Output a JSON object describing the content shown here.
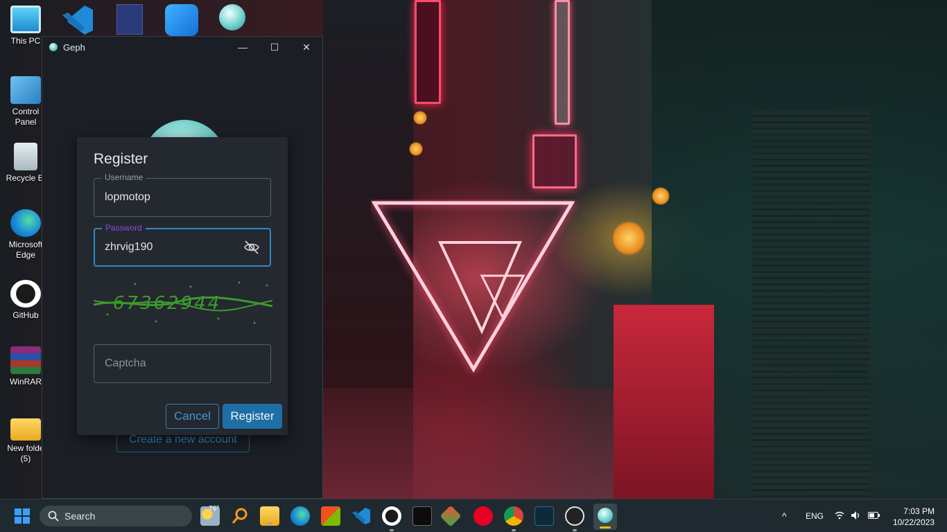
{
  "desktop": {
    "icons": [
      {
        "label": "This PC",
        "icon": "this-pc-icon"
      },
      {
        "label": "Control Panel",
        "icon": "control-panel-icon"
      },
      {
        "label": "Recycle Bi",
        "icon": "recycle-bin-icon"
      },
      {
        "label": "Microsoft Edge",
        "icon": "edge-icon"
      },
      {
        "label": "GitHub",
        "icon": "github-icon"
      },
      {
        "label": "WinRAR",
        "icon": "winrar-icon"
      },
      {
        "label": "New folde (5)",
        "icon": "folder-icon"
      }
    ],
    "top_row_icons": [
      "vscode-icon",
      "calculator-app-icon",
      "shareit-icon",
      "geph-icon"
    ]
  },
  "window": {
    "title": "Geph",
    "minimize_symbol": "—",
    "maximize_symbol": "☐",
    "close_symbol": "✕",
    "create_account_label": "Create a new account"
  },
  "register_dialog": {
    "title": "Register",
    "username": {
      "label": "Username",
      "value": "lopmotop"
    },
    "password": {
      "label": "Password",
      "value": "zhrvig190",
      "visibility_icon": "eye-off-icon"
    },
    "captcha_image_text": "67362944",
    "captcha_input": {
      "placeholder": "Captcha",
      "value": ""
    },
    "cancel_label": "Cancel",
    "register_label": "Register"
  },
  "taskbar": {
    "search_placeholder": "Search",
    "weather_temp": "76°",
    "pinned": [
      "start-icon",
      "weather-icon",
      "search-app-icon",
      "file-explorer-icon",
      "edge-icon",
      "store-icon",
      "vscode-icon",
      "github-desktop-icon",
      "terminal-icon",
      "git-icon",
      "pinterest-icon",
      "chrome-icon",
      "streaming-app-icon",
      "media-player-icon",
      "geph-icon"
    ],
    "tray": {
      "chevron": "^",
      "language": "ENG",
      "time": "7:03 PM",
      "date": "10/22/2023"
    }
  },
  "colors": {
    "accent": "#2d8ac7",
    "register_button": "#1e6fa6",
    "focused_legend": "#8a4bd9",
    "captcha_green": "#3c9a2e"
  }
}
